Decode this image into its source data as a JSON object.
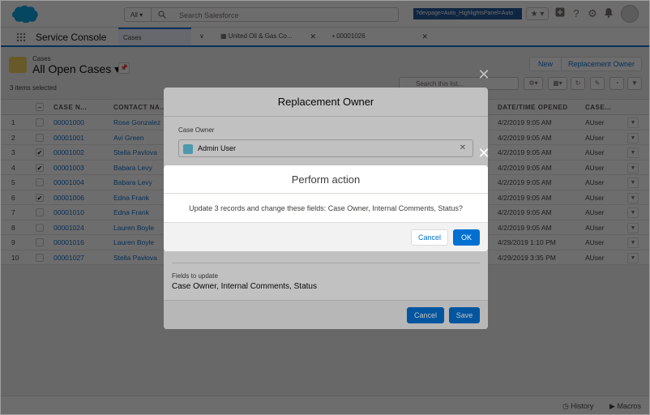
{
  "header": {
    "search_scope": "All",
    "search_placeholder": "Search Salesforce",
    "url_badge": "?devpage=Auto_HighlightsPanel=Auto",
    "favorites_glyph": "★",
    "icons": [
      "add-icon",
      "help-icon",
      "setup-gear-icon",
      "notifications-bell-icon"
    ]
  },
  "nav": {
    "app_name": "Service Console",
    "tabs": [
      {
        "label": "Cases",
        "close": ""
      },
      {
        "label": "United Oil & Gas Co...",
        "close": "✕"
      },
      {
        "label": "00001026",
        "close": "✕"
      }
    ]
  },
  "list": {
    "object_label": "Cases",
    "list_name": "All Open Cases",
    "selected_count": "3 items selected",
    "search_placeholder": "Search this list...",
    "buttons": {
      "new": "New",
      "replacement_owner": "Replacement Owner"
    }
  },
  "table": {
    "columns": [
      "CASE N...",
      "CONTACT NA...",
      "DATE/TIME OPENED",
      "CASE..."
    ],
    "rows": [
      {
        "num": "1",
        "checked": false,
        "case": "00001000",
        "contact": "Rose Gonzalez",
        "opened": "4/2/2019 9:05 AM",
        "owner": "AUser"
      },
      {
        "num": "2",
        "checked": false,
        "case": "00001001",
        "contact": "Avi Green",
        "opened": "4/2/2019 9:05 AM",
        "owner": "AUser"
      },
      {
        "num": "3",
        "checked": true,
        "case": "00001002",
        "contact": "Stella Pavlova",
        "opened": "4/2/2019 9:05 AM",
        "owner": "AUser"
      },
      {
        "num": "4",
        "checked": true,
        "case": "00001003",
        "contact": "Babara Levy",
        "opened": "4/2/2019 9:05 AM",
        "owner": "AUser"
      },
      {
        "num": "5",
        "checked": false,
        "case": "00001004",
        "contact": "Babara Levy",
        "opened": "4/2/2019 9:05 AM",
        "owner": "AUser"
      },
      {
        "num": "6",
        "checked": true,
        "case": "00001006",
        "contact": "Edna Frank",
        "opened": "4/2/2019 9:05 AM",
        "owner": "AUser"
      },
      {
        "num": "7",
        "checked": false,
        "case": "00001010",
        "contact": "Edna Frank",
        "opened": "4/2/2019 9:05 AM",
        "owner": "AUser"
      },
      {
        "num": "8",
        "checked": false,
        "case": "00001024",
        "contact": "Lauren Boyle",
        "opened": "4/2/2019 9:05 AM",
        "owner": "AUser"
      },
      {
        "num": "9",
        "checked": false,
        "case": "00001016",
        "contact": "Lauren Boyle",
        "opened": "4/29/2019 1:10 PM",
        "owner": "AUser"
      },
      {
        "num": "10",
        "checked": false,
        "case": "00001027",
        "contact": "Stella Pavlova",
        "opened": "4/29/2019 3:35 PM",
        "owner": "AUser"
      }
    ]
  },
  "utility_bar": {
    "history": "History",
    "macros": "Macros"
  },
  "replacement_modal": {
    "title": "Replacement Owner",
    "case_owner_label": "Case Owner",
    "case_owner_value": "Admin User",
    "fields_label": "Fields to update",
    "fields_value": "Case Owner, Internal Comments, Status",
    "cancel": "Cancel",
    "save": "Save"
  },
  "confirm_modal": {
    "title": "Perform action",
    "message": "Update 3 records and change these fields: Case Owner, Internal Comments, Status?",
    "cancel": "Cancel",
    "ok": "OK"
  },
  "colors": {
    "brand": "#0070d2",
    "link": "#006dcc",
    "header_blue": "#1b5297",
    "cloud": "#00a1e0"
  }
}
